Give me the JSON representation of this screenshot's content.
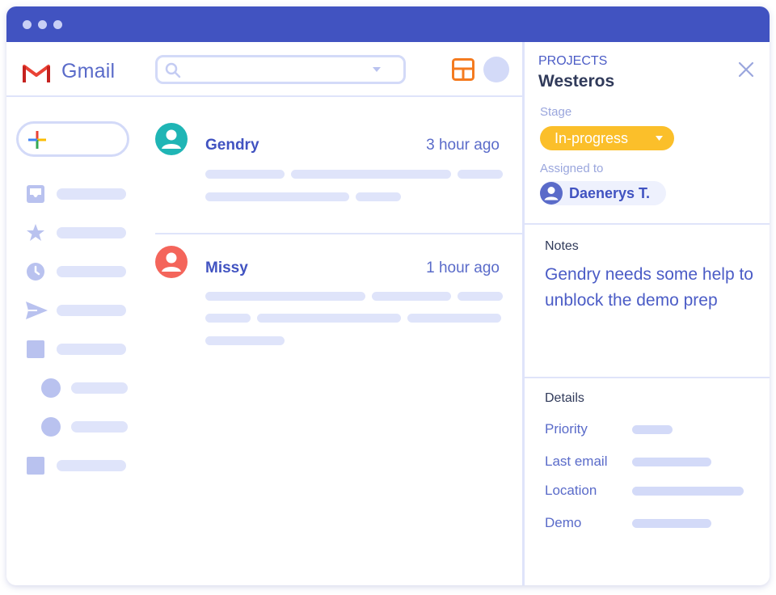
{
  "app": {
    "name": "Gmail"
  },
  "search": {
    "placeholder": ""
  },
  "messages": [
    {
      "sender": "Gendry",
      "time": "3 hour ago",
      "avatar_color": "#1fb5b5"
    },
    {
      "sender": "Missy",
      "time": "1 hour ago",
      "avatar_color": "#f4655b"
    }
  ],
  "panel": {
    "section_label": "PROJECTS",
    "project_name": "Westeros",
    "stage_label": "Stage",
    "stage_value": "In-progress",
    "assigned_label": "Assigned to",
    "assignee": "Daenerys T.",
    "notes_label": "Notes",
    "notes_text": "Gendry needs some help to unblock the demo prep",
    "details_label": "Details",
    "details": [
      {
        "label": "Priority"
      },
      {
        "label": "Last email"
      },
      {
        "label": "Location"
      },
      {
        "label": "Demo"
      }
    ]
  },
  "colors": {
    "titlebar": "#4153c1",
    "accent": "#4153c1",
    "stage": "#fbbf2a",
    "layout_icon": "#f47b20"
  },
  "icons": [
    "gmail-logo-icon",
    "search-icon",
    "dropdown-caret-icon",
    "layout-icon",
    "plus-icon",
    "inbox-icon",
    "star-icon",
    "clock-icon",
    "send-icon",
    "square-icon",
    "circle-icon",
    "close-icon",
    "person-icon"
  ]
}
